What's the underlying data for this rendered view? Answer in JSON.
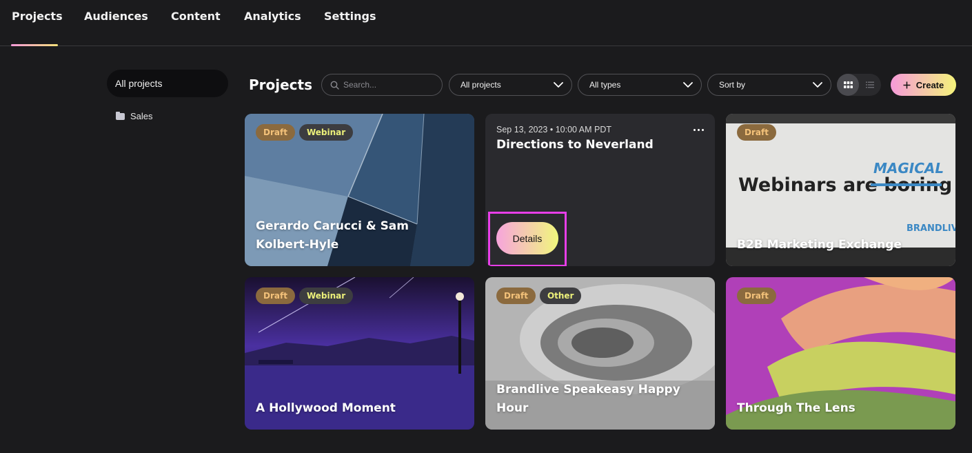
{
  "nav": {
    "tabs": [
      "Projects",
      "Audiences",
      "Content",
      "Analytics",
      "Settings"
    ],
    "active_tab": "Projects"
  },
  "sidebar": {
    "all_projects_label": "All projects",
    "folders": [
      {
        "label": "Sales",
        "icon": "folder-icon"
      }
    ]
  },
  "toolbar": {
    "title": "Projects",
    "search_placeholder": "Search...",
    "filter_projects": "All projects",
    "filter_types": "All types",
    "sort_label": "Sort by",
    "view_mode": "grid",
    "create_label": "Create"
  },
  "cards": [
    {
      "status": "Draft",
      "type": "Webinar",
      "title": "Gerardo Carucci & Sam Kolbert-Hyle"
    },
    {
      "date": "Sep 13, 2023 • 10:00 AM PDT",
      "title": "Directions to Neverland",
      "details_label": "Details"
    },
    {
      "status": "Draft",
      "title": "B2B Marketing Exchange",
      "image_text": "Webinars are boring MAGICAL"
    },
    {
      "status": "Draft",
      "type": "Webinar",
      "title": "A Hollywood Moment"
    },
    {
      "status": "Draft",
      "type": "Other",
      "title": "Brandlive Speakeasy Happy Hour"
    },
    {
      "status": "Draft",
      "title": "Through The Lens"
    }
  ],
  "colors": {
    "background": "#1b1b1d",
    "accent_gradient_start": "#f59ad9",
    "accent_gradient_end": "#f4f37a",
    "highlight_frame": "#e83ee8",
    "draft_badge_text": "#f4c27a",
    "type_badge_text": "#ecf07a"
  }
}
